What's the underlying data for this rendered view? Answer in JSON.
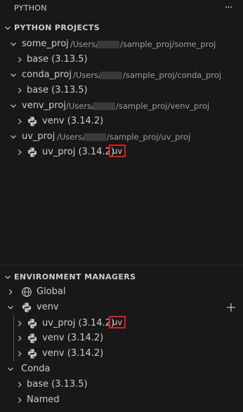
{
  "header": {
    "title": "PYTHON",
    "more_icon": "ellipsis-icon"
  },
  "projects": {
    "title": "PYTHON PROJECTS",
    "items": [
      {
        "name": "some_proj",
        "path_prefix": "/Users/",
        "path_suffix": "/sample_proj/some_proj",
        "children": [
          {
            "label": "base (3.13.5)"
          }
        ]
      },
      {
        "name": "conda_proj",
        "path_prefix": "/Users/",
        "path_suffix": "/sample_proj/conda_proj",
        "children": [
          {
            "label": "base (3.13.5)"
          }
        ]
      },
      {
        "name": "venv_proj",
        "path_prefix": "/Users/",
        "path_suffix": "/sample_proj/venv_proj",
        "children": [
          {
            "label": "venv (3.14.2)",
            "icon": "python-icon"
          }
        ]
      },
      {
        "name": "uv_proj",
        "path_prefix": "/Users/",
        "path_suffix": "/sample_proj/uv_proj",
        "children": [
          {
            "label": "uv_proj (3.14.2)",
            "icon": "python-icon",
            "badge": "uv"
          }
        ]
      }
    ]
  },
  "managers": {
    "title": "ENVIRONMENT MANAGERS",
    "items": [
      {
        "label": "Global",
        "icon": "globe-icon",
        "expanded": false
      },
      {
        "label": "venv",
        "icon": "python-icon",
        "expanded": true,
        "action_icon": "add-icon",
        "children": [
          {
            "label": "uv_proj (3.14.2)",
            "icon": "python-icon",
            "badge": "uv"
          },
          {
            "label": "venv (3.14.2)",
            "icon": "python-icon"
          },
          {
            "label": "venv (3.14.2)",
            "icon": "python-icon"
          }
        ]
      },
      {
        "label": "Conda",
        "expanded": true,
        "children": [
          {
            "label": "base (3.13.5)"
          },
          {
            "label": "Named"
          }
        ]
      }
    ]
  },
  "colors": {
    "background": "#181818",
    "text": "#cccccc",
    "description": "#9d9d9d",
    "highlight_border": "#e01b1b"
  }
}
